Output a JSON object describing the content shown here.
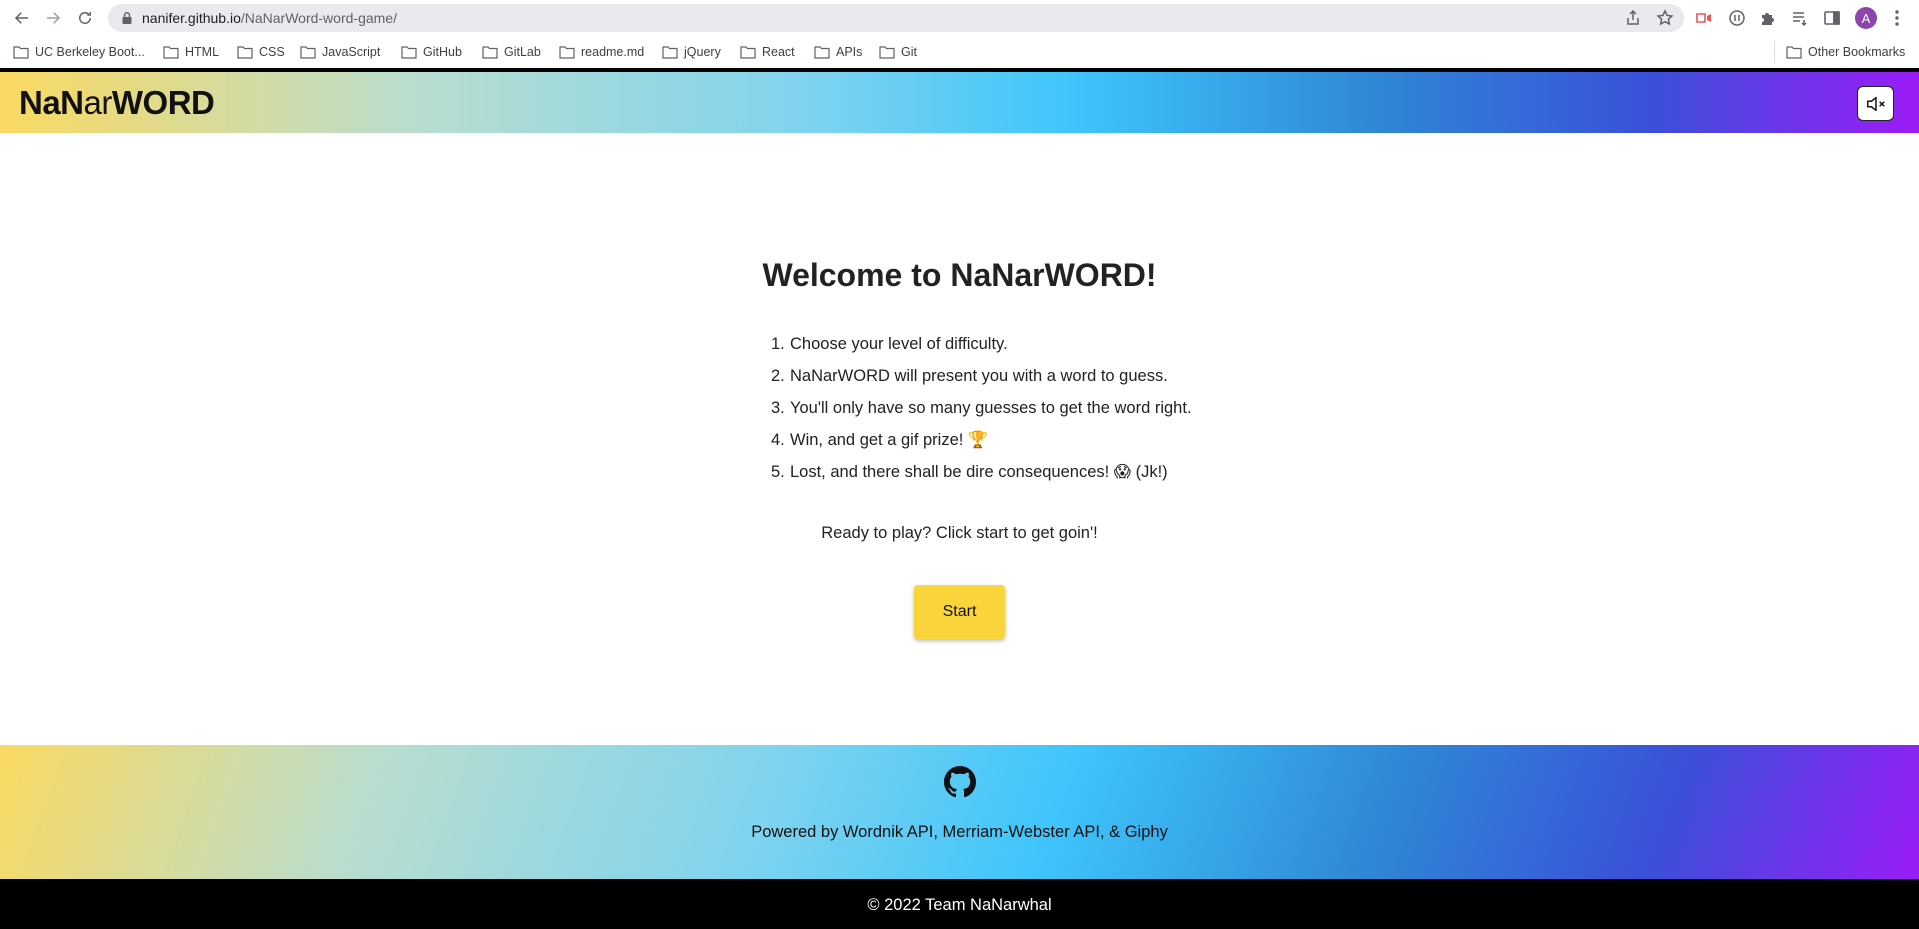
{
  "browser": {
    "url_host": "nanifer.github.io",
    "url_path": "/NaNarWord-word-game/",
    "avatar_letter": "A",
    "bookmarks": [
      "UC Berkeley Boot...",
      "HTML",
      "CSS",
      "JavaScript",
      "GitHub",
      "GitLab",
      "readme.md",
      "jQuery",
      "React",
      "APIs",
      "Git"
    ],
    "other_bookmarks": "Other Bookmarks"
  },
  "header": {
    "logo_part1": "NaN",
    "logo_part2": "ar",
    "logo_part3": "WORD",
    "mute_icon": "speaker-muted-icon"
  },
  "main": {
    "welcome_prefix": "Welcome to ",
    "welcome_brand_1": "NaN",
    "welcome_brand_2": "ar",
    "welcome_brand_3": "WORD",
    "welcome_suffix": "!",
    "steps": [
      {
        "num": "1.",
        "text": "Choose your level of difficulty."
      },
      {
        "num": "2.",
        "text": "NaNarWORD will present you with a word to guess."
      },
      {
        "num": "3.",
        "text": "You'll only have so many guesses to get the word right."
      },
      {
        "num": "4.",
        "text": "Win, and get a gif prize! 🏆"
      },
      {
        "num": "5.",
        "text": "Lost, and there shall be dire consequences! 😱 (Jk!)"
      }
    ],
    "ready_text": "Ready to play? Click start to get goin'!",
    "start_label": "Start"
  },
  "footer": {
    "github_icon": "github-icon",
    "powered_text": "Powered by Wordnik API, Merriam-Webster API, & Giphy",
    "copyright": "© 2022 Team NaNarwhal"
  },
  "colors": {
    "gradient": [
      "#fad961",
      "#3ec5fb",
      "#9b1cf8"
    ],
    "start_button": "#fad43b",
    "copyright_bar": "#000000"
  }
}
